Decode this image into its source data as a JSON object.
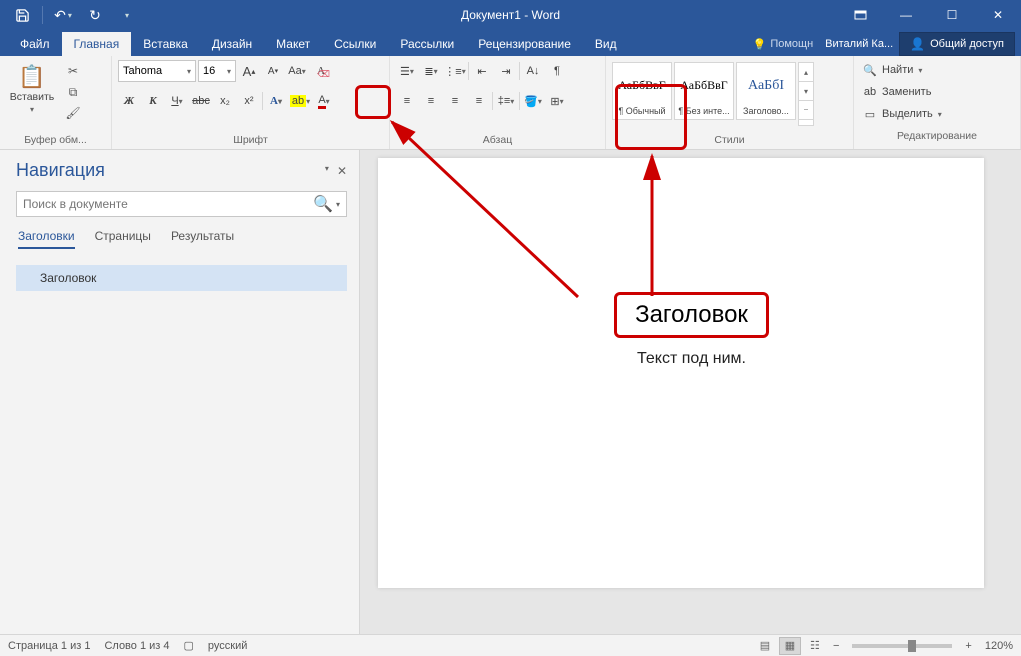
{
  "title": "Документ1 - Word",
  "tabs": [
    "Файл",
    "Главная",
    "Вставка",
    "Дизайн",
    "Макет",
    "Ссылки",
    "Рассылки",
    "Рецензирование",
    "Вид"
  ],
  "active_tab": 1,
  "tell_me": "Помощн",
  "user": "Виталий Ка...",
  "share": "Общий доступ",
  "clipboard": {
    "paste": "Вставить",
    "group": "Буфер обм..."
  },
  "font": {
    "name": "Tahoma",
    "size": "16",
    "bold": "Ж",
    "italic": "К",
    "underline": "Ч",
    "strike": "abc",
    "sub": "x₂",
    "sup": "x²",
    "case": "Aa",
    "upA": "A",
    "dnA": "A",
    "group": "Шрифт"
  },
  "para": {
    "group": "Абзац"
  },
  "styles": {
    "items": [
      {
        "preview": "АаБбВвГ",
        "label": "¶ Обычный"
      },
      {
        "preview": "АаБбВвГ",
        "label": "¶ Без инте..."
      },
      {
        "preview": "АаБбІ",
        "label": "Заголово..."
      }
    ],
    "group": "Стили"
  },
  "editing": {
    "find": "Найти",
    "replace": "Заменить",
    "select": "Выделить",
    "group": "Редактирование"
  },
  "nav": {
    "title": "Навигация",
    "search_placeholder": "Поиск в документе",
    "tabs": [
      "Заголовки",
      "Страницы",
      "Результаты"
    ],
    "active": 0,
    "item": "Заголовок"
  },
  "doc": {
    "heading": "Заголовок",
    "body": "Текст под ним."
  },
  "status": {
    "page": "Страница 1 из 1",
    "words": "Слово 1 из 4",
    "lang": "русский",
    "zoom": "120%"
  }
}
